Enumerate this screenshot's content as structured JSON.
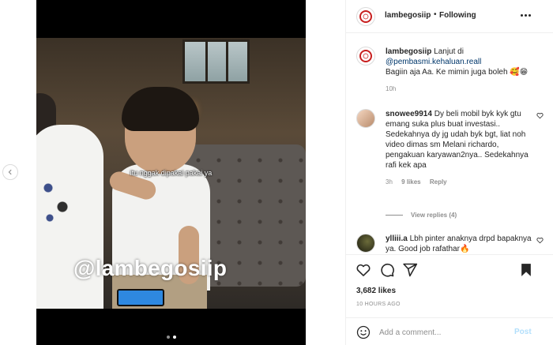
{
  "post": {
    "username": "lambegosiip",
    "separator": "•",
    "follow_label": "Following"
  },
  "media": {
    "caption_overlay": "itu nggak dipakai pakai ya",
    "watermark": "@lambegosiip",
    "slide_count": 2,
    "active_slide": 2
  },
  "caption": {
    "username": "lambegosiip",
    "text_before_mention": "Lanjut di",
    "mention": "@pembasmi.kehaluan.reall",
    "text_after_mention": "Bagiin aja Aa. Ke mimin juga boleh 🥰😁",
    "time": "10h"
  },
  "comments": [
    {
      "username": "snowee9914",
      "text": "Dy beli mobil byk kyk gtu emang suka plus buat investasi.. Sedekahnya dy jg udah byk bgt, liat noh video dimas sm Melani richardo, pengakuan karyawan2nya.. Sedekahnya rafi kek apa",
      "time": "3h",
      "likes": "9 likes",
      "reply_label": "Reply",
      "view_replies": "View replies (4)"
    },
    {
      "username": "ylliii.a",
      "text": "Lbh pinter anaknya drpd bapaknya ya. Good job rafathar🔥"
    }
  ],
  "stats": {
    "likes": "3,682 likes",
    "posted_ago": "10 HOURS AGO"
  },
  "add_comment": {
    "placeholder": "Add a comment...",
    "post_label": "Post"
  },
  "colors": {
    "text": "#262626",
    "muted": "#8e8e8e",
    "link": "#00376b",
    "post_disabled": "#b2dffc",
    "border": "#efefef"
  },
  "icons": [
    "chevron-left-icon",
    "speaker-muted-icon",
    "more-horizontal-icon",
    "heart-icon",
    "comment-icon",
    "share-icon",
    "bookmark-icon",
    "emoji-icon"
  ]
}
